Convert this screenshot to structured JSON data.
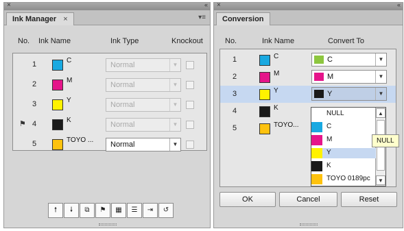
{
  "ink_manager": {
    "tab_label": "Ink Manager",
    "tab_close": "×",
    "headers": {
      "no": "No.",
      "ink_name": "Ink Name",
      "ink_type": "Ink Type",
      "knockout": "Knockout"
    },
    "rows": [
      {
        "no": "1",
        "name": "C",
        "color": "#19a9e1",
        "type": "Normal",
        "enabled": false
      },
      {
        "no": "2",
        "name": "M",
        "color": "#e5158a",
        "type": "Normal",
        "enabled": false
      },
      {
        "no": "3",
        "name": "Y",
        "color": "#fff200",
        "type": "Normal",
        "enabled": false
      },
      {
        "no": "4",
        "name": "K",
        "color": "#1a1a1a",
        "type": "Normal",
        "enabled": false,
        "flag": "⚑"
      },
      {
        "no": "5",
        "name": "TOYO ...",
        "color": "#fec20e",
        "type": "Normal",
        "enabled": true
      }
    ],
    "toolbar_icons": [
      "move-up-icon",
      "move-down-icon",
      "duplicate-icon",
      "flag-icon",
      "ink-alias-icon",
      "ink-list-icon",
      "merge-icon",
      "reset-icon"
    ],
    "toolbar_glyphs": [
      "🠕",
      "🠗",
      "⧉",
      "⚑",
      "▦",
      "☰",
      "⇥",
      "↺"
    ]
  },
  "conversion": {
    "tab_label": "Conversion",
    "headers": {
      "no": "No.",
      "ink_name": "Ink Name",
      "convert_to": "Convert To"
    },
    "rows": [
      {
        "no": "1",
        "name": "C",
        "color": "#19a9e1",
        "convert_to": "C",
        "convert_color": "#8dc63f"
      },
      {
        "no": "2",
        "name": "M",
        "color": "#e5158a",
        "convert_to": "M",
        "convert_color": "#e5158a"
      },
      {
        "no": "3",
        "name": "Y",
        "color": "#fff200",
        "convert_to": "Y",
        "convert_color": "#1a1a1a",
        "selected": true
      },
      {
        "no": "4",
        "name": "K",
        "color": "#1a1a1a"
      },
      {
        "no": "5",
        "name": "TOYO...",
        "color": "#fec20e"
      }
    ],
    "dropdown_options": [
      {
        "label": "NULL",
        "color": "#ffffff"
      },
      {
        "label": "C",
        "color": "#19a9e1"
      },
      {
        "label": "M",
        "color": "#e5158a"
      },
      {
        "label": "Y",
        "color": "#fff200",
        "highlighted": true
      },
      {
        "label": "K",
        "color": "#1a1a1a"
      },
      {
        "label": "TOYO 0189pc",
        "color": "#fec20e"
      }
    ],
    "tooltip": "NULL",
    "buttons": {
      "ok": "OK",
      "cancel": "Cancel",
      "reset": "Reset"
    }
  }
}
